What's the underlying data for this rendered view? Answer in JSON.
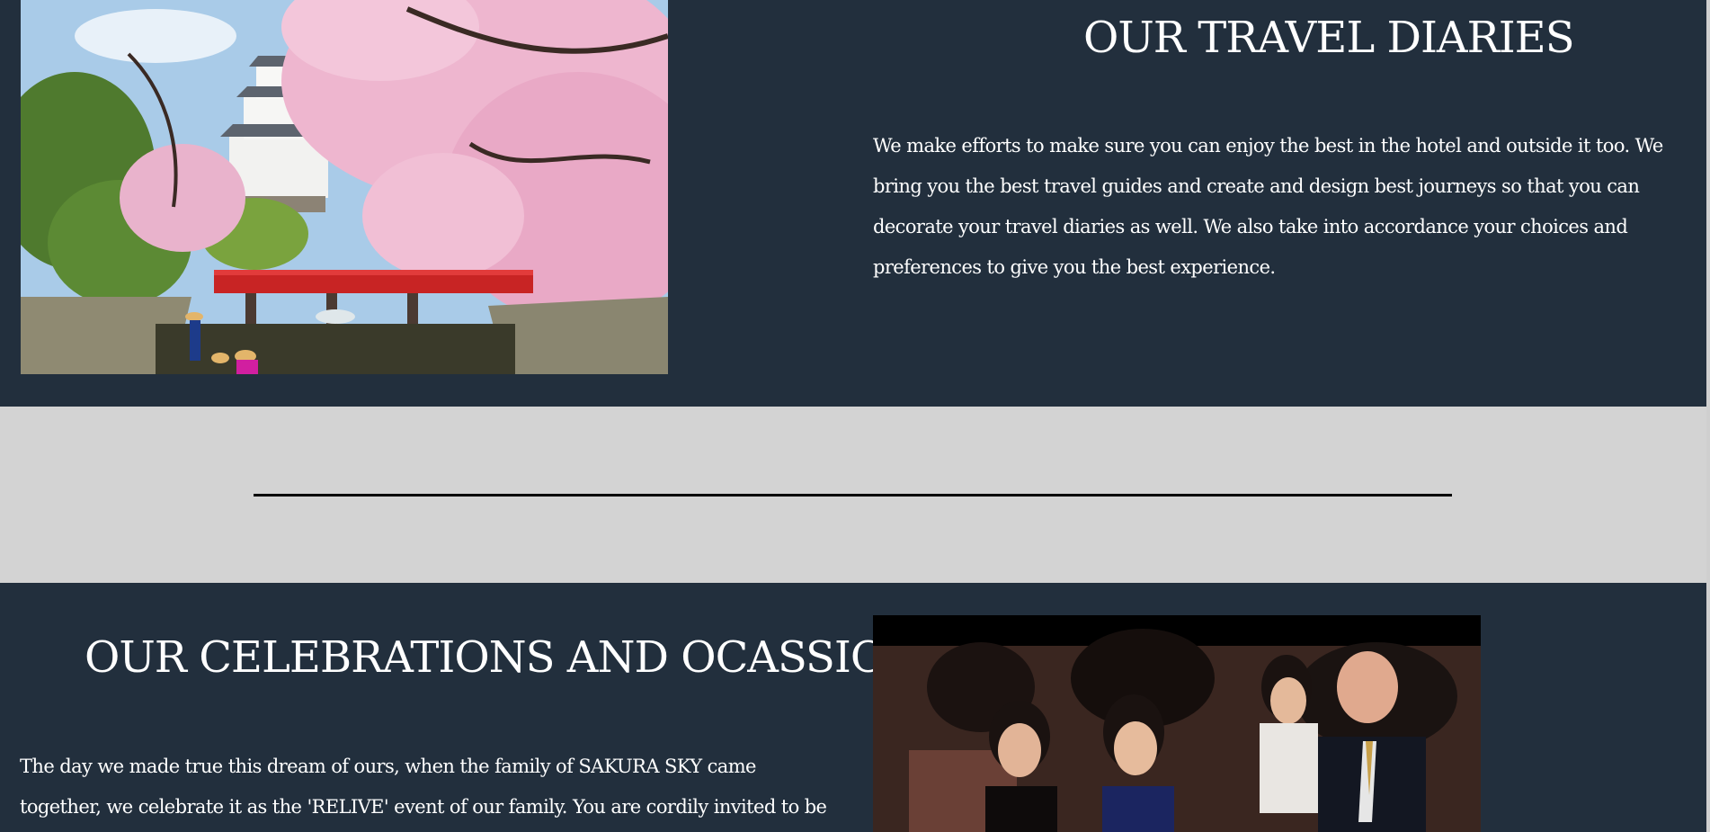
{
  "travel_diaries": {
    "title": "OUR TRAVEL DIARIES",
    "body": "We make efforts to make sure you can enjoy the best in the hotel and outside it too. We bring you the best travel guides and create and design best journeys so that you can decorate your travel diaries as well. We also take into accordance your choices and preferences to give you the best experience."
  },
  "celebrations": {
    "title": "OUR CELEBRATIONS AND OCASSIONS",
    "body": "The day we made true this dream of ours, when the family of SAKURA SKY came together, we celebrate it as the 'RELIVE' event of our family. You are cordily invited to be a part of this event in"
  },
  "colors": {
    "section_bg": "#222f3d",
    "divider_bg": "#d3d3d3",
    "divider_line": "#000000",
    "text": "#ffffff"
  }
}
